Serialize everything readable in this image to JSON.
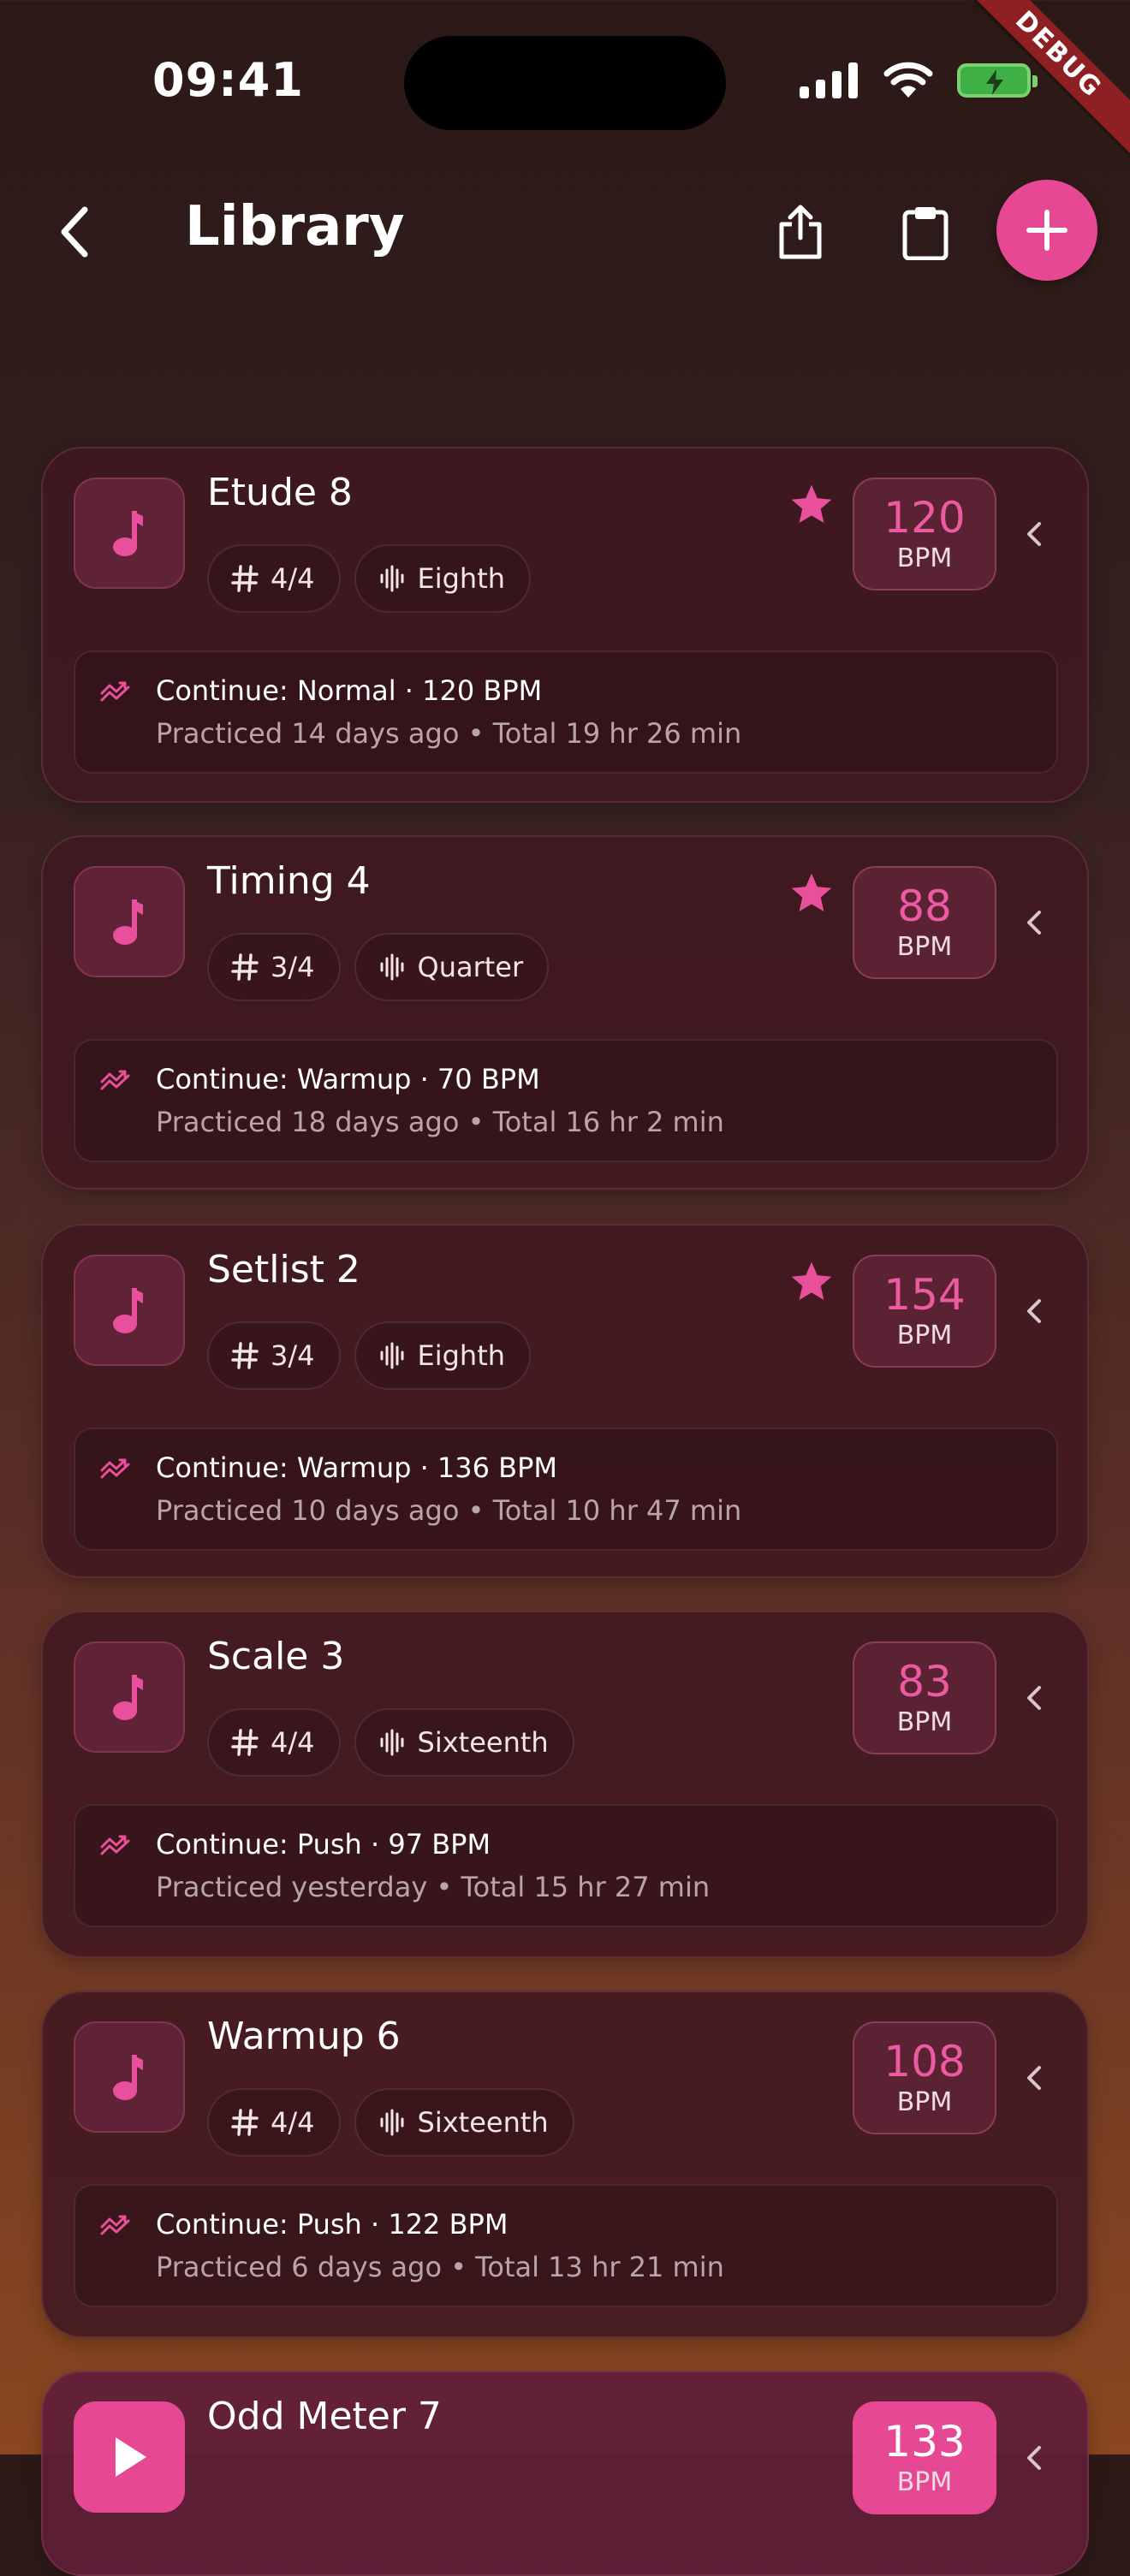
{
  "status_bar": {
    "time": "09:41",
    "debug_label": "DEBUG"
  },
  "header": {
    "title": "Library"
  },
  "unit_label": "BPM",
  "cards": [
    {
      "title": "Etude 8",
      "time_signature": "4/4",
      "subdivision": "Eighth",
      "bpm": "120",
      "favorite": true,
      "line1": "Continue: Normal · 120 BPM",
      "line2": "Practiced 14 days ago • Total 19 hr 26 min"
    },
    {
      "title": "Timing 4",
      "time_signature": "3/4",
      "subdivision": "Quarter",
      "bpm": "88",
      "favorite": true,
      "line1": "Continue: Warmup · 70 BPM",
      "line2": "Practiced 18 days ago • Total 16 hr 2 min"
    },
    {
      "title": "Setlist 2",
      "time_signature": "3/4",
      "subdivision": "Eighth",
      "bpm": "154",
      "favorite": true,
      "line1": "Continue: Warmup · 136 BPM",
      "line2": "Practiced 10 days ago • Total 10 hr 47 min"
    },
    {
      "title": "Scale 3",
      "time_signature": "4/4",
      "subdivision": "Sixteenth",
      "bpm": "83",
      "favorite": false,
      "line1": "Continue: Push · 97 BPM",
      "line2": "Practiced yesterday • Total 15 hr 27 min"
    },
    {
      "title": "Warmup 6",
      "time_signature": "4/4",
      "subdivision": "Sixteenth",
      "bpm": "108",
      "favorite": false,
      "line1": "Continue: Push · 122 BPM",
      "line2": "Practiced 6 days ago • Total 13 hr 21 min"
    },
    {
      "title": "Odd Meter 7",
      "bpm": "133",
      "playing": true
    }
  ],
  "colors": {
    "accent": "#e64894",
    "card_bg": "#401820",
    "muted_text": "#b9a4aa"
  }
}
